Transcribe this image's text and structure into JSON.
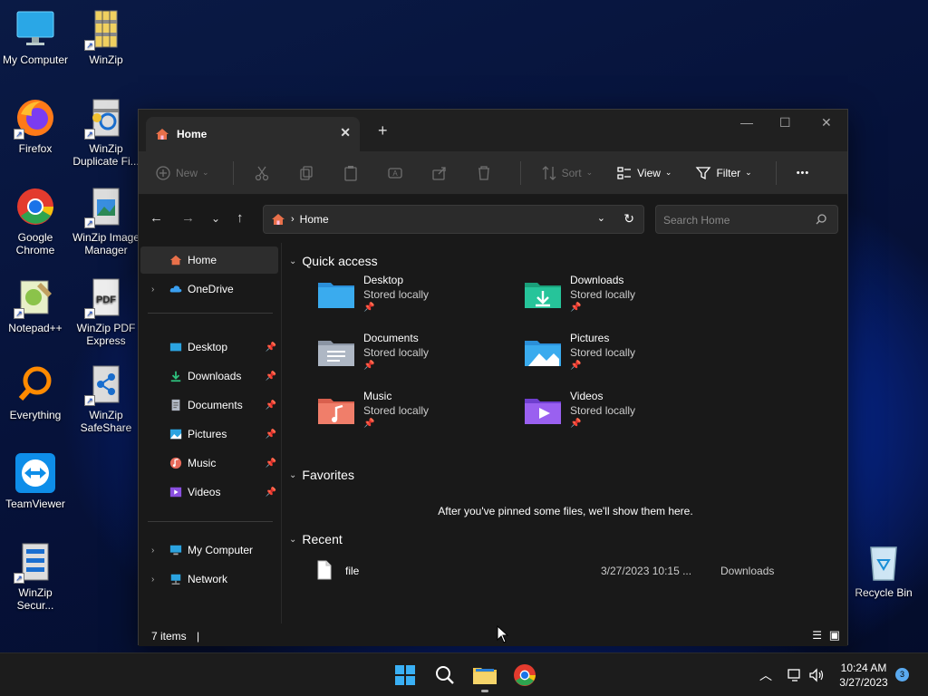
{
  "desktop": {
    "icons": [
      {
        "label": "My Computer"
      },
      {
        "label": "WinZip"
      },
      {
        "label": "Firefox"
      },
      {
        "label": "WinZip Duplicate Fi..."
      },
      {
        "label": "Google Chrome"
      },
      {
        "label": "WinZip Image Manager"
      },
      {
        "label": "Notepad++"
      },
      {
        "label": "WinZip PDF Express"
      },
      {
        "label": "Everything"
      },
      {
        "label": "WinZip SafeShare"
      },
      {
        "label": "TeamViewer"
      },
      {
        "label": "WinZip Secur..."
      },
      {
        "label": "Recycle Bin"
      }
    ]
  },
  "window": {
    "tab_title": "Home",
    "close_tab": "✕",
    "new_tab": "+",
    "controls": {
      "minimize": "—",
      "maximize": "☐",
      "close": "✕"
    },
    "commands": {
      "new": "New",
      "sort": "Sort",
      "view": "View",
      "filter": "Filter",
      "more": "•••"
    },
    "address": {
      "location": "Home"
    },
    "search": {
      "placeholder": "Search Home"
    },
    "sidebar": {
      "home": "Home",
      "onedrive": "OneDrive",
      "pinned": [
        {
          "label": "Desktop"
        },
        {
          "label": "Downloads"
        },
        {
          "label": "Documents"
        },
        {
          "label": "Pictures"
        },
        {
          "label": "Music"
        },
        {
          "label": "Videos"
        }
      ],
      "my_computer": "My Computer",
      "network": "Network"
    },
    "main": {
      "quick_access_title": "Quick access",
      "quick_access": [
        {
          "name": "Desktop",
          "status": "Stored locally"
        },
        {
          "name": "Downloads",
          "status": "Stored locally"
        },
        {
          "name": "Documents",
          "status": "Stored locally"
        },
        {
          "name": "Pictures",
          "status": "Stored locally"
        },
        {
          "name": "Music",
          "status": "Stored locally"
        },
        {
          "name": "Videos",
          "status": "Stored locally"
        }
      ],
      "favorites_title": "Favorites",
      "favorites_empty": "After you've pinned some files, we'll show them here.",
      "recent_title": "Recent",
      "recent": [
        {
          "name": "file",
          "date": "3/27/2023 10:15 ...",
          "location": "Downloads"
        }
      ]
    },
    "status": {
      "items": "7 items"
    }
  },
  "taskbar": {
    "time": "10:24 AM",
    "date": "3/27/2023",
    "notifications": "3"
  },
  "colors": {
    "accent": "#0078d4",
    "window_bg": "#191919",
    "cmdbar_bg": "#2c2c2c",
    "folder_yellow": "#f3c74d"
  }
}
